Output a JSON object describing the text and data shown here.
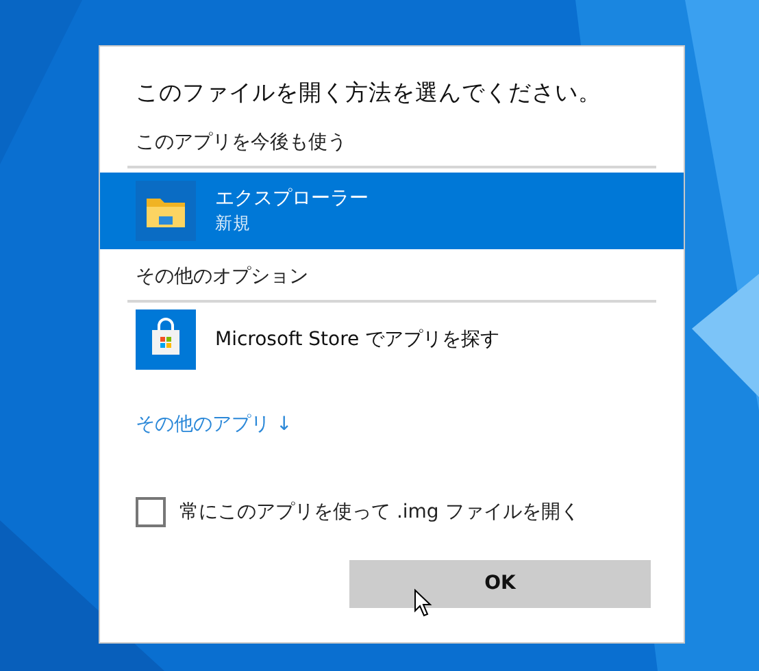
{
  "dialog": {
    "title": "このファイルを開く方法を選んでください。",
    "sections": [
      {
        "header": "このアプリを今後も使う",
        "items": [
          {
            "kind": "explorer",
            "name": "エクスプローラー",
            "subtitle": "新規",
            "selected": true
          }
        ]
      },
      {
        "header": "その他のオプション",
        "items": [
          {
            "kind": "store",
            "name": "Microsoft Store でアプリを探す",
            "selected": false
          }
        ]
      }
    ],
    "more_link": "その他のアプリ ↓",
    "always_checkbox": {
      "label": "常にこのアプリを使って .img ファイルを開く",
      "checked": false
    },
    "ok_button": "OK"
  }
}
